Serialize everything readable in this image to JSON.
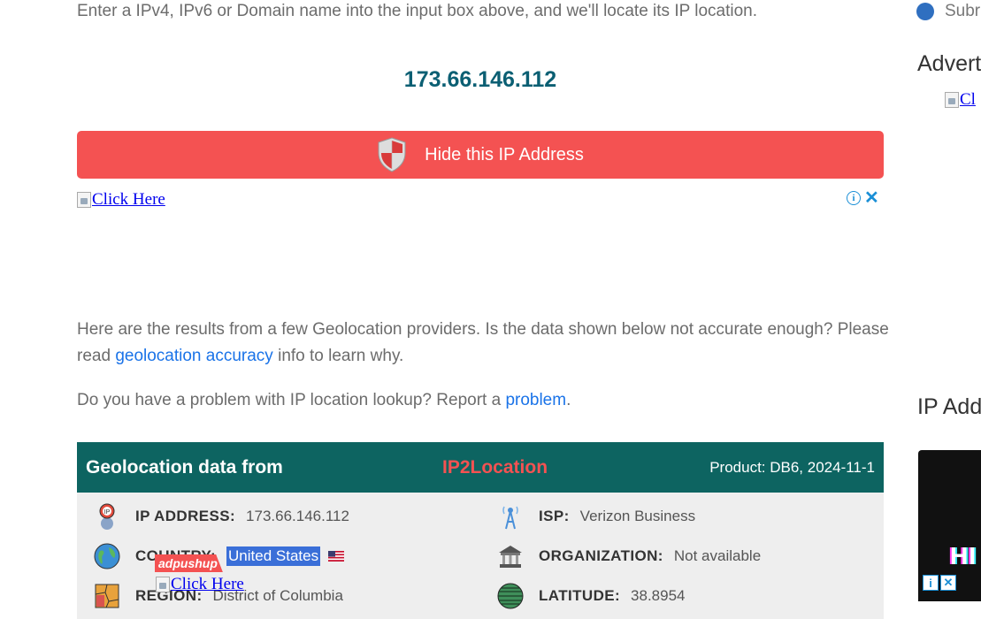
{
  "intro_text": "Enter a IPv4, IPv6 or Domain name into the input box above, and we'll locate its IP location.",
  "ip_display": "173.66.146.112",
  "hide_button_label": "Hide this IP Address",
  "ad_link_text": "Click Here",
  "paragraph1": {
    "before": "Here are the results from a few Geolocation providers. Is the data shown below not accurate enough? Please read ",
    "link": "geolocation accuracy",
    "after": " info to learn why."
  },
  "paragraph2": {
    "before": "Do you have a problem with IP location lookup? Report a ",
    "link": "problem",
    "after": "."
  },
  "geo_header": {
    "title": "Geolocation data from",
    "brand": "IP2Location",
    "product": "Product: DB6, 2024-11-1"
  },
  "fields": {
    "ip_address": {
      "label": "IP ADDRESS:",
      "value": "173.66.146.112"
    },
    "country": {
      "label": "COUNTRY:",
      "value": "United States"
    },
    "region": {
      "label": "REGION:",
      "value": "District of Columbia"
    },
    "isp": {
      "label": "ISP:",
      "value": "Verizon Business"
    },
    "organization": {
      "label": "ORGANIZATION:",
      "value": "Not available"
    },
    "latitude": {
      "label": "LATITUDE:",
      "value": "38.8954"
    }
  },
  "adpushup_badge": "adpushup",
  "sidebar": {
    "subscribe_text": "Subr",
    "advert_heading": "Advert",
    "ad_link_text": "Cl",
    "ip_heading": "IP Add",
    "dark_ad_text": "HI"
  },
  "colors": {
    "accent_red": "#f45252",
    "header_teal": "#0d6461",
    "ip_blue": "#0b5f73",
    "link_blue": "#1a73e8"
  }
}
